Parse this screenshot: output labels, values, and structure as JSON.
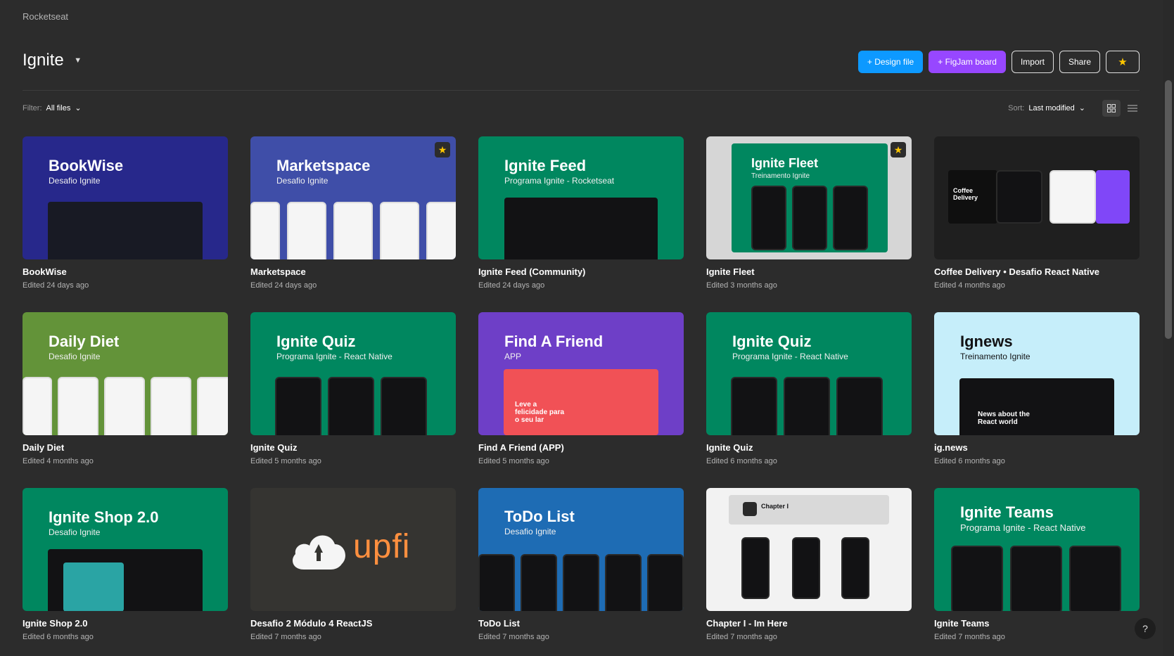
{
  "team": "Rocketseat",
  "project": {
    "title": "Ignite"
  },
  "actions": {
    "design_file": "+ Design file",
    "figjam_board": "+ FigJam board",
    "import": "Import",
    "share": "Share",
    "star_icon": "★"
  },
  "filter": {
    "label": "Filter:",
    "value": "All files"
  },
  "sort": {
    "label": "Sort:",
    "value": "Last modified"
  },
  "files": [
    {
      "name": "BookWise",
      "edited": "Edited 24 days ago",
      "thumb_title": "BookWise",
      "thumb_sub": "Desafio Ignite",
      "bg": "#27288b",
      "favorite": false
    },
    {
      "name": "Marketspace",
      "edited": "Edited 24 days ago",
      "thumb_title": "Marketspace",
      "thumb_sub": "Desafio Ignite",
      "bg": "#3f4ea8",
      "favorite": true
    },
    {
      "name": "Ignite Feed (Community)",
      "edited": "Edited 24 days ago",
      "thumb_title": "Ignite Feed",
      "thumb_sub": "Programa Ignite - Rocketseat",
      "bg": "#00875f",
      "favorite": false
    },
    {
      "name": "Ignite Fleet",
      "edited": "Edited 3 months ago",
      "thumb_title": "Ignite Fleet",
      "thumb_sub": "Treinamento Ignite",
      "bg": "#d6d6d6",
      "favorite": true
    },
    {
      "name": "Coffee Delivery • Desafio React Native",
      "edited": "Edited 4 months ago",
      "thumb_title": "",
      "thumb_sub": "",
      "bg": "#1f1f1f",
      "favorite": false
    },
    {
      "name": "Daily Diet",
      "edited": "Edited 4 months ago",
      "thumb_title": "Daily Diet",
      "thumb_sub": "Desafio Ignite",
      "bg": "#639339",
      "favorite": false
    },
    {
      "name": "Ignite Quiz",
      "edited": "Edited 5 months ago",
      "thumb_title": "Ignite Quiz",
      "thumb_sub": "Programa Ignite - React Native",
      "bg": "#00875f",
      "favorite": false
    },
    {
      "name": "Find A Friend (APP)",
      "edited": "Edited 5 months ago",
      "thumb_title": "Find A Friend",
      "thumb_sub": "APP",
      "bg": "#6e3fc7",
      "favorite": false
    },
    {
      "name": "Ignite Quiz",
      "edited": "Edited 6 months ago",
      "thumb_title": "Ignite Quiz",
      "thumb_sub": "Programa Ignite - React Native",
      "bg": "#00875f",
      "favorite": false
    },
    {
      "name": "ig.news",
      "edited": "Edited 6 months ago",
      "thumb_title": "Ignews",
      "thumb_sub": "Treinamento Ignite",
      "bg": "#c6eefa",
      "favorite": false
    },
    {
      "name": "Ignite Shop 2.0",
      "edited": "Edited 6 months ago",
      "thumb_title": "Ignite Shop 2.0",
      "thumb_sub": "Desafio Ignite",
      "bg": "#00875f",
      "favorite": false
    },
    {
      "name": "Desafio 2 Módulo 4 ReactJS",
      "edited": "Edited 7 months ago",
      "thumb_title": "upfi",
      "thumb_sub": "",
      "bg": "#353431",
      "favorite": false
    },
    {
      "name": "ToDo List",
      "edited": "Edited 7 months ago",
      "thumb_title": "ToDo List",
      "thumb_sub": "Desafio Ignite",
      "bg": "#1e6cb4",
      "favorite": false
    },
    {
      "name": "Chapter I - Im Here",
      "edited": "Edited 7 months ago",
      "thumb_title": "Chapter I",
      "thumb_sub": "",
      "bg": "#f2f2f2",
      "favorite": false
    },
    {
      "name": "Ignite Teams",
      "edited": "Edited 7 months ago",
      "thumb_title": "Ignite Teams",
      "thumb_sub": "Programa Ignite - React Native",
      "bg": "#00875f",
      "favorite": false
    }
  ],
  "thumb_text": {
    "coffee": "Coffee Delivery",
    "findfriend": "Leve a felicidade para o seu lar",
    "ignews": "News about the React world"
  },
  "help": "?"
}
